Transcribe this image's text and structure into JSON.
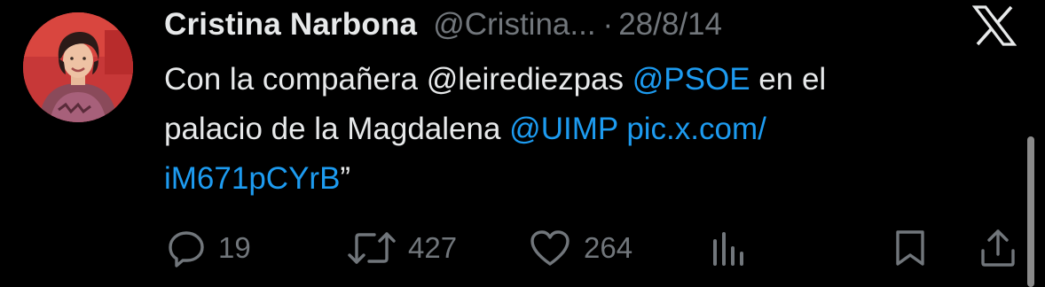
{
  "author": {
    "display_name": "Cristina Narbona",
    "handle": "@Cristina...",
    "separator": "·",
    "date": "28/8/14"
  },
  "tweet": {
    "line1": {
      "part1": "Con la compañera @leirediezpas ",
      "mention_psoe": "@PSOE",
      "part2": " en el"
    },
    "line2": {
      "part1": "palacio de la Magdalena ",
      "mention_uimp": "@UIMP",
      "space": " ",
      "link_start": "pic.x.com/"
    },
    "line3": {
      "link_end": "iM671pCYrB",
      "quote": "”"
    }
  },
  "actions": {
    "reply_count": "19",
    "retweet_count": "427",
    "like_count": "264"
  },
  "icons": {
    "logo": "x-logo-icon",
    "reply": "reply-icon",
    "retweet": "retweet-icon",
    "like": "heart-icon",
    "views": "views-chart-icon",
    "bookmark": "bookmark-icon",
    "share": "share-icon"
  },
  "colors": {
    "background": "#000000",
    "text": "#e7e9ea",
    "muted": "#71767b",
    "link": "#1d9bf0"
  }
}
